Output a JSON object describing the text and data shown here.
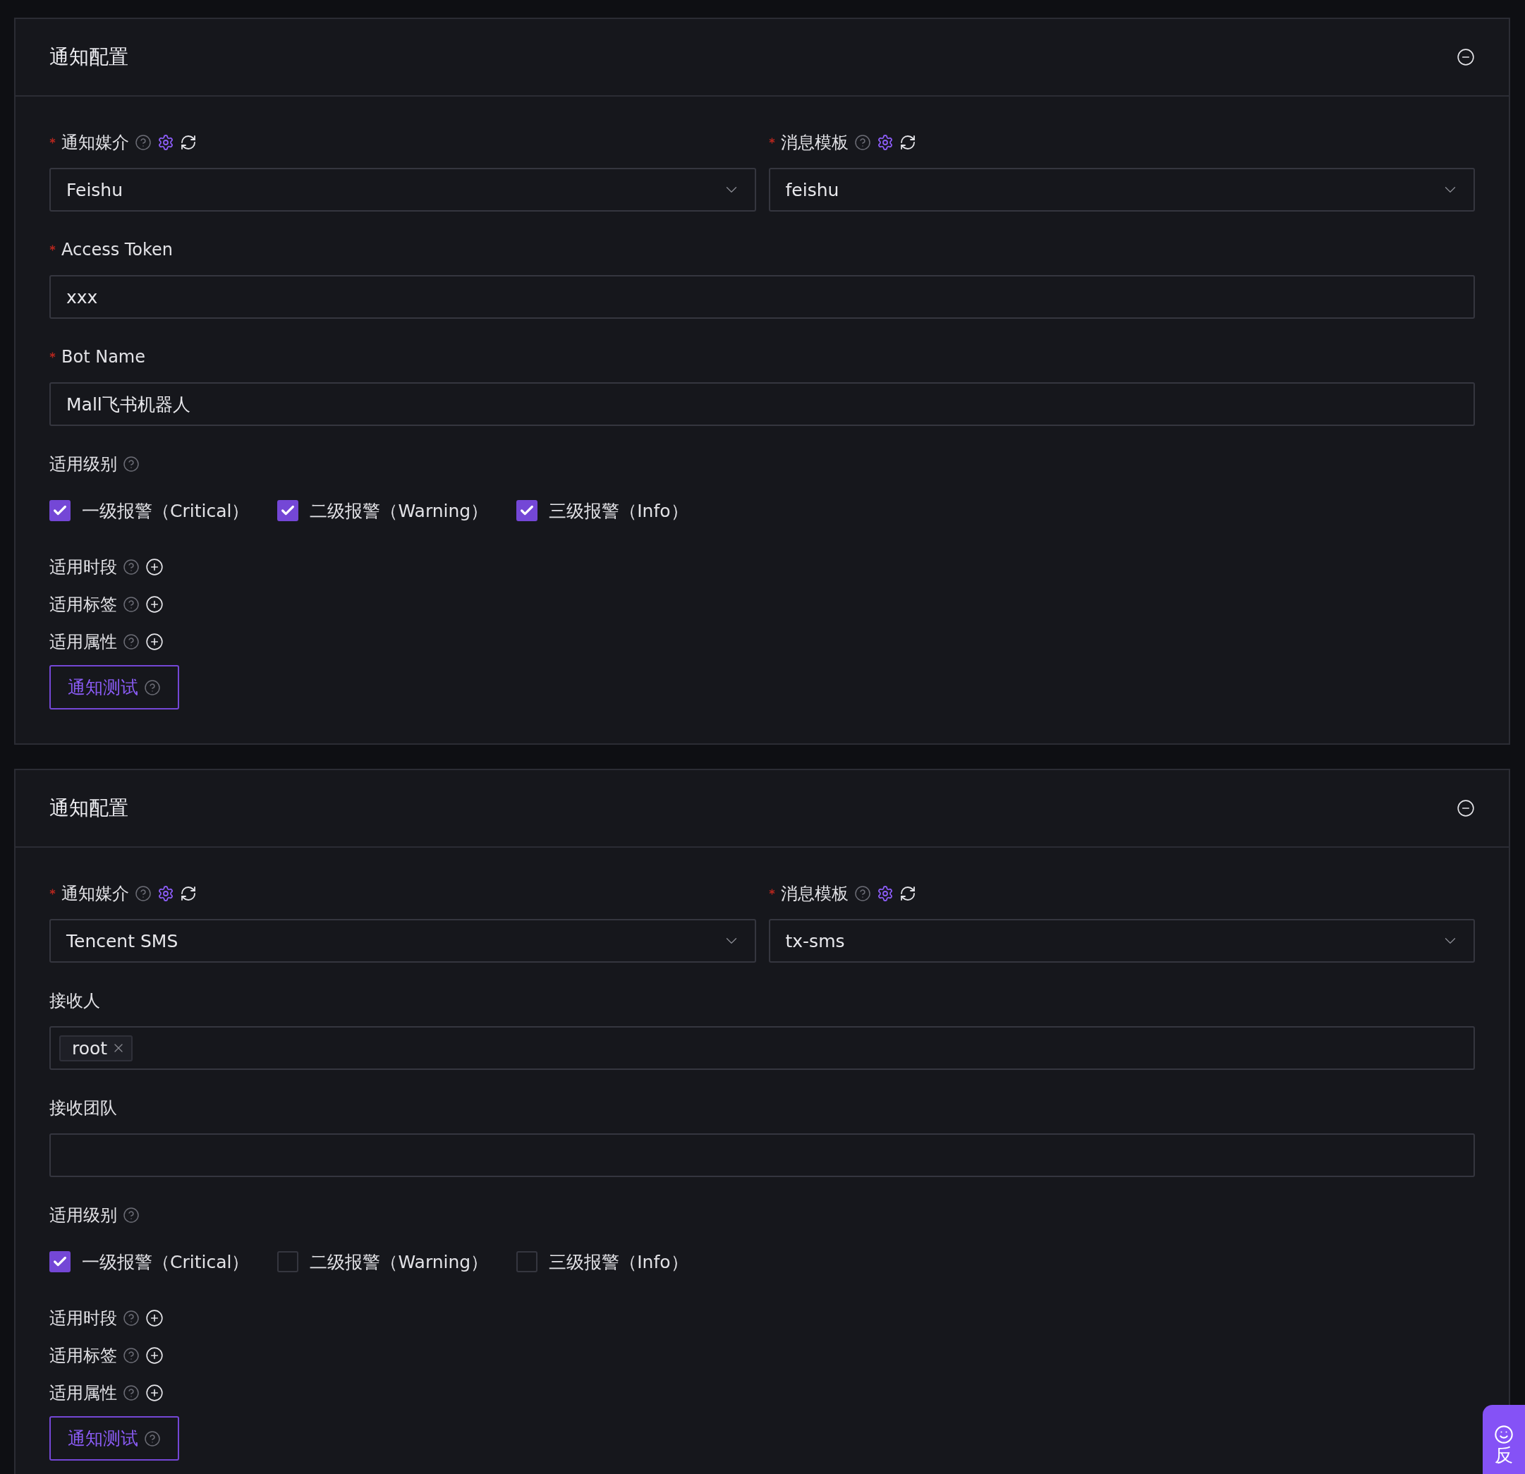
{
  "cards": [
    {
      "title": "通知配置",
      "selects": [
        {
          "label": "通知媒介",
          "required": true,
          "value": "Feishu"
        },
        {
          "label": "消息模板",
          "required": true,
          "value": "feishu"
        }
      ],
      "fields": [
        {
          "kind": "input",
          "label": "Access Token",
          "required": true,
          "value": "xxx"
        },
        {
          "kind": "input",
          "label": "Bot Name",
          "required": true,
          "value": "Mall飞书机器人"
        }
      ],
      "levels": {
        "label": "适用级别",
        "options": [
          {
            "label": "一级报警（Critical）",
            "checked": true
          },
          {
            "label": "二级报警（Warning）",
            "checked": true
          },
          {
            "label": "三级报警（Info）",
            "checked": true
          }
        ]
      },
      "filters": [
        {
          "label": "适用时段"
        },
        {
          "label": "适用标签"
        },
        {
          "label": "适用属性"
        }
      ],
      "test_button": {
        "label": "通知测试"
      }
    },
    {
      "title": "通知配置",
      "selects": [
        {
          "label": "通知媒介",
          "required": true,
          "value": "Tencent SMS"
        },
        {
          "label": "消息模板",
          "required": true,
          "value": "tx-sms"
        }
      ],
      "fields": [
        {
          "kind": "tags",
          "label": "接收人",
          "required": false,
          "tags": [
            "root"
          ]
        },
        {
          "kind": "input",
          "label": "接收团队",
          "required": false
        }
      ],
      "levels": {
        "label": "适用级别",
        "options": [
          {
            "label": "一级报警（Critical）",
            "checked": true
          },
          {
            "label": "二级报警（Warning）",
            "checked": false
          },
          {
            "label": "三级报警（Info）",
            "checked": false
          }
        ]
      },
      "filters": [
        {
          "label": "适用时段"
        },
        {
          "label": "适用标签"
        },
        {
          "label": "适用属性"
        }
      ],
      "test_button": {
        "label": "通知测试"
      }
    }
  ],
  "feedback": {
    "label": "反"
  }
}
